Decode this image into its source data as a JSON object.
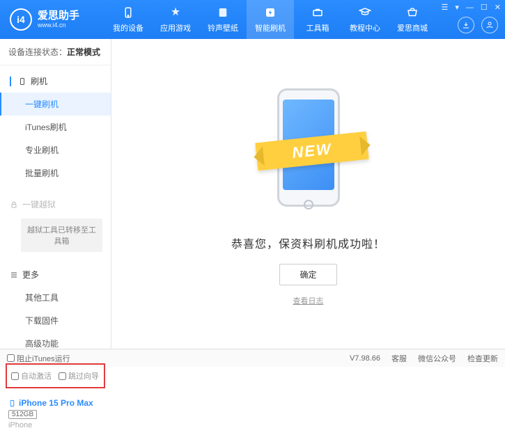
{
  "app": {
    "name": "爱思助手",
    "url": "www.i4.cn"
  },
  "topnav": {
    "items": [
      {
        "label": "我的设备"
      },
      {
        "label": "应用游戏"
      },
      {
        "label": "铃声壁纸"
      },
      {
        "label": "智能刷机"
      },
      {
        "label": "工具箱"
      },
      {
        "label": "教程中心"
      },
      {
        "label": "爱思商城"
      }
    ],
    "active_index": 3
  },
  "connection": {
    "label": "设备连接状态：",
    "value": "正常模式"
  },
  "sidebar": {
    "flash": {
      "title": "刷机",
      "items": [
        "一键刷机",
        "iTunes刷机",
        "专业刷机",
        "批量刷机"
      ],
      "active_index": 0
    },
    "jailbreak": {
      "title": "一键越狱",
      "note": "越狱工具已转移至工具箱"
    },
    "more": {
      "title": "更多",
      "items": [
        "其他工具",
        "下载固件",
        "高级功能"
      ]
    },
    "checks": {
      "auto_activate": "自动激活",
      "skip_guide": "跳过向导"
    },
    "device": {
      "name": "iPhone 15 Pro Max",
      "storage": "512GB",
      "type": "iPhone"
    }
  },
  "main": {
    "banner": "NEW",
    "success": "恭喜您，保资料刷机成功啦！",
    "ok": "确定",
    "log": "查看日志"
  },
  "footer": {
    "block_itunes": "阻止iTunes运行",
    "version": "V7.98.66",
    "links": [
      "客服",
      "微信公众号",
      "检查更新"
    ]
  }
}
